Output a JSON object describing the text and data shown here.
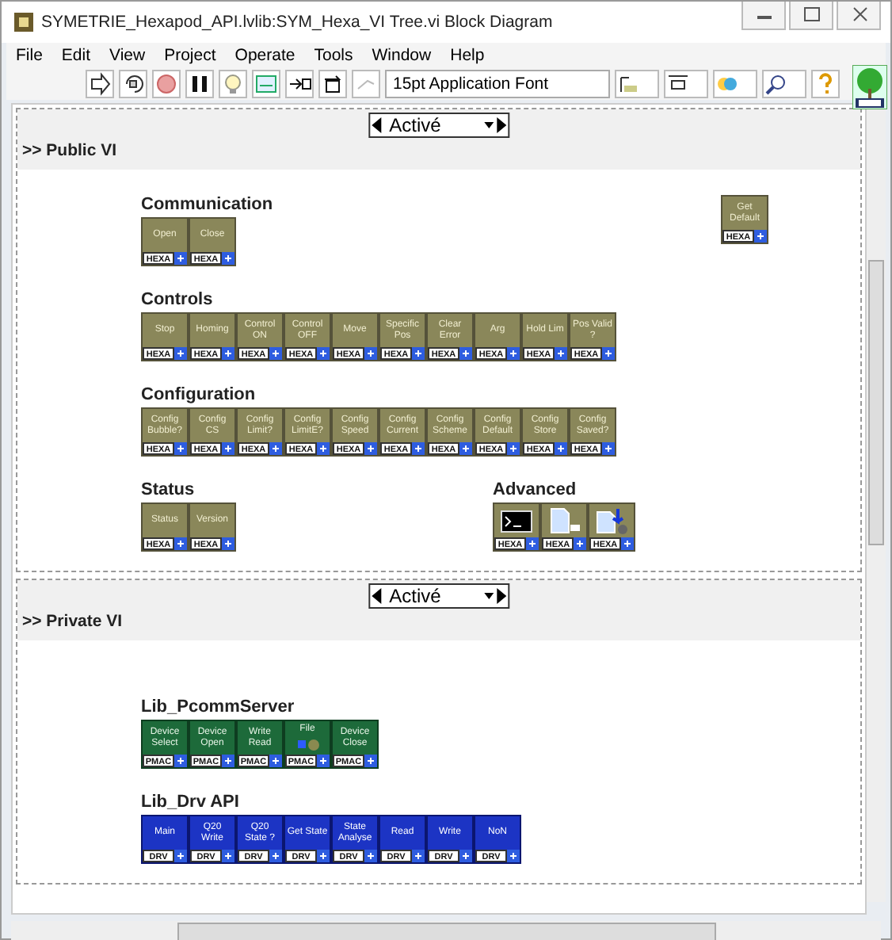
{
  "window": {
    "title": "SYMETRIE_Hexapod_API.lvlib:SYM_Hexa_VI Tree.vi Block Diagram"
  },
  "menu": [
    "File",
    "Edit",
    "View",
    "Project",
    "Operate",
    "Tools",
    "Window",
    "Help"
  ],
  "toolbar": {
    "font": "15pt Application Font"
  },
  "frames": [
    {
      "selector": "Activé",
      "title": ">> Public VI",
      "groups": [
        {
          "title": "Communication",
          "kind": "hexa",
          "icons": [
            {
              "kind": "text",
              "label": "Open",
              "tag": "HEXA"
            },
            {
              "kind": "text",
              "label": "Close",
              "tag": "HEXA"
            }
          ]
        },
        {
          "kind": "hexa",
          "icons": [
            {
              "kind": "text",
              "label": "Get Default",
              "tag": "HEXA"
            }
          ]
        },
        {
          "title": "Controls",
          "kind": "hexa",
          "icons": [
            {
              "kind": "text",
              "label": "Stop",
              "tag": "HEXA"
            },
            {
              "kind": "text",
              "label": "Homing",
              "tag": "HEXA"
            },
            {
              "kind": "text",
              "label": "Control ON",
              "tag": "HEXA"
            },
            {
              "kind": "text",
              "label": "Control OFF",
              "tag": "HEXA"
            },
            {
              "kind": "text",
              "label": "Move",
              "tag": "HEXA"
            },
            {
              "kind": "text",
              "label": "Specific Pos",
              "tag": "HEXA"
            },
            {
              "kind": "text",
              "label": "Clear Error",
              "tag": "HEXA"
            },
            {
              "kind": "text",
              "label": "Arg",
              "tag": "HEXA"
            },
            {
              "kind": "text",
              "label": "Hold Lim",
              "tag": "HEXA"
            },
            {
              "kind": "text",
              "label": "Pos Valid ?",
              "tag": "HEXA"
            }
          ]
        },
        {
          "title": "Configuration",
          "kind": "hexa",
          "icons": [
            {
              "kind": "text",
              "label": "Config Bubble?",
              "tag": "HEXA"
            },
            {
              "kind": "text",
              "label": "Config CS",
              "tag": "HEXA"
            },
            {
              "kind": "text",
              "label": "Config Limit?",
              "tag": "HEXA"
            },
            {
              "kind": "text",
              "label": "Config LimitE?",
              "tag": "HEXA"
            },
            {
              "kind": "text",
              "label": "Config Speed",
              "tag": "HEXA"
            },
            {
              "kind": "text",
              "label": "Config Current",
              "tag": "HEXA"
            },
            {
              "kind": "text",
              "label": "Config Scheme",
              "tag": "HEXA"
            },
            {
              "kind": "text",
              "label": "Config Default",
              "tag": "HEXA"
            },
            {
              "kind": "text",
              "label": "Config Store",
              "tag": "HEXA"
            },
            {
              "kind": "text",
              "label": "Config Saved?",
              "tag": "HEXA"
            }
          ]
        },
        {
          "title": "Status",
          "kind": "hexa",
          "icons": [
            {
              "kind": "text",
              "label": "Status",
              "tag": "HEXA"
            },
            {
              "kind": "text",
              "label": "Version",
              "tag": "HEXA"
            }
          ]
        },
        {
          "title": "Advanced",
          "kind": "hexa",
          "icons": [
            {
              "kind": "terminal",
              "tag": "HEXA"
            },
            {
              "kind": "document",
              "tag": "HEXA"
            },
            {
              "kind": "document-arrow",
              "tag": "HEXA"
            }
          ]
        }
      ]
    },
    {
      "selector": "Activé",
      "title": ">> Private VI",
      "groups": [
        {
          "title": "Lib_PcommServer",
          "kind": "pmac",
          "icons": [
            {
              "kind": "text",
              "label": "Device Select",
              "tag": "PMAC"
            },
            {
              "kind": "text",
              "label": "Device Open",
              "tag": "PMAC"
            },
            {
              "kind": "text",
              "label": "Write Read",
              "tag": "PMAC"
            },
            {
              "kind": "file",
              "label": "File",
              "tag": "PMAC"
            },
            {
              "kind": "text",
              "label": "Device Close",
              "tag": "PMAC"
            }
          ]
        },
        {
          "title": "Lib_Drv API",
          "kind": "drv",
          "icons": [
            {
              "kind": "text",
              "label": "Main",
              "tag": "DRV"
            },
            {
              "kind": "text",
              "label": "Q20 Write",
              "tag": "DRV"
            },
            {
              "kind": "text",
              "label": "Q20 State ?",
              "tag": "DRV"
            },
            {
              "kind": "text",
              "label": "Get State",
              "tag": "DRV"
            },
            {
              "kind": "text",
              "label": "State Analyse",
              "tag": "DRV"
            },
            {
              "kind": "text",
              "label": "Read",
              "tag": "DRV"
            },
            {
              "kind": "text",
              "label": "Write",
              "tag": "DRV"
            },
            {
              "kind": "text",
              "label": "NoN",
              "tag": "DRV"
            }
          ]
        }
      ]
    }
  ]
}
